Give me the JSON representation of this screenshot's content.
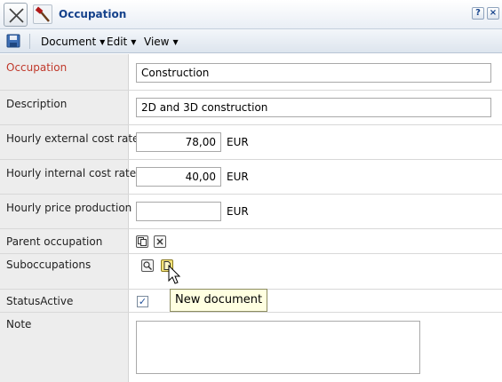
{
  "window": {
    "title": "Occupation",
    "help_label": "?",
    "close_label": "×"
  },
  "menu": {
    "items": [
      {
        "label": "Document"
      },
      {
        "label": "Edit"
      },
      {
        "label": "View"
      }
    ]
  },
  "form": {
    "occupation": {
      "label": "Occupation",
      "value": "Construction"
    },
    "description": {
      "label": "Description",
      "value": "2D and 3D construction"
    },
    "external_rate": {
      "label": "Hourly external cost rate",
      "value": "78,00",
      "unit": "EUR"
    },
    "internal_rate": {
      "label": "Hourly internal cost rate",
      "value": "40,00",
      "unit": "EUR"
    },
    "price_production": {
      "label": "Hourly price production",
      "value": "",
      "unit": "EUR"
    },
    "parent_occupation": {
      "label": "Parent occupation"
    },
    "suboccupations": {
      "label": "Suboccupations"
    },
    "status_active": {
      "label": "StatusActive",
      "checked": true,
      "check_glyph": "✓"
    },
    "note": {
      "label": "Note",
      "value": ""
    }
  },
  "tooltip": {
    "text": "New document"
  },
  "colors": {
    "title_text": "#15428b",
    "required_label": "#c0392b",
    "label_background": "#ededed",
    "tooltip_background": "#ffffe1",
    "highlight_button": "#f5e27a"
  }
}
